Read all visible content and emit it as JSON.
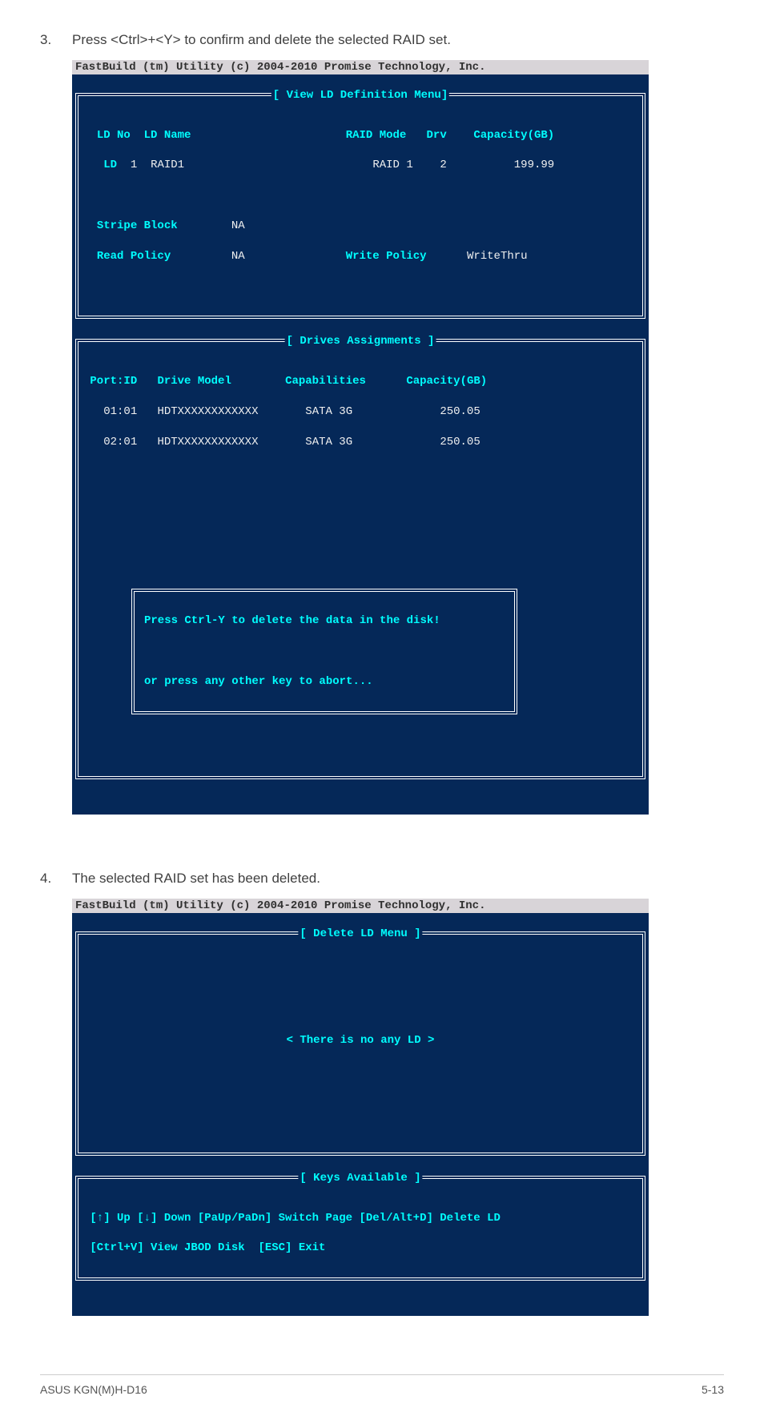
{
  "step3": {
    "num": "3.",
    "text": "Press <Ctrl>+<Y> to confirm and delete the selected RAID set."
  },
  "step4": {
    "num": "4.",
    "text": "The selected RAID set has been deleted."
  },
  "term_header": "FastBuild (tm) Utility (c) 2004-2010 Promise Technology, Inc.",
  "t1": {
    "box1_title": "[ View LD Definition Menu]",
    "hdr_ldno": "LD No",
    "hdr_ldname": "LD Name",
    "hdr_raidmode": "RAID Mode",
    "hdr_drv": "Drv",
    "hdr_cap": "Capacity(GB)",
    "r_ld": "LD",
    "r_slot": "1",
    "r_name": "RAID1",
    "r_mode": "RAID 1",
    "r_drv": "2",
    "r_cap": "199.99",
    "l_stripe": "Stripe Block",
    "v_stripe": "NA",
    "l_read": "Read Policy",
    "v_read": "NA",
    "l_write": "Write Policy",
    "v_write": "WriteThru",
    "box2_title": "[ Drives Assignments ]",
    "h2_port": "Port:ID",
    "h2_model": "Drive Model",
    "h2_caps": "Capabilities",
    "h2_cap": "Capacity(GB)",
    "row1": {
      "port": "01:01",
      "model": "HDTXXXXXXXXXXXX",
      "caps": "SATA 3G",
      "cap": "250.05"
    },
    "row2": {
      "port": "02:01",
      "model": "HDTXXXXXXXXXXXX",
      "caps": "SATA 3G",
      "cap": "250.05"
    },
    "popup1": "Press Ctrl-Y to delete the data in the disk!",
    "popup2": "or press any other key to abort..."
  },
  "t2": {
    "box1_title": "[ Delete LD Menu ]",
    "empty": "< There is no any LD >",
    "box2_title": "[ Keys Available ]",
    "keys1": "[↑] Up [↓] Down [PaUp/PaDn] Switch Page [Del/Alt+D] Delete LD",
    "keys2": "[Ctrl+V] View JBOD Disk  [ESC] Exit"
  },
  "footer": {
    "left": "ASUS KGN(M)H-D16",
    "right": "5-13"
  }
}
